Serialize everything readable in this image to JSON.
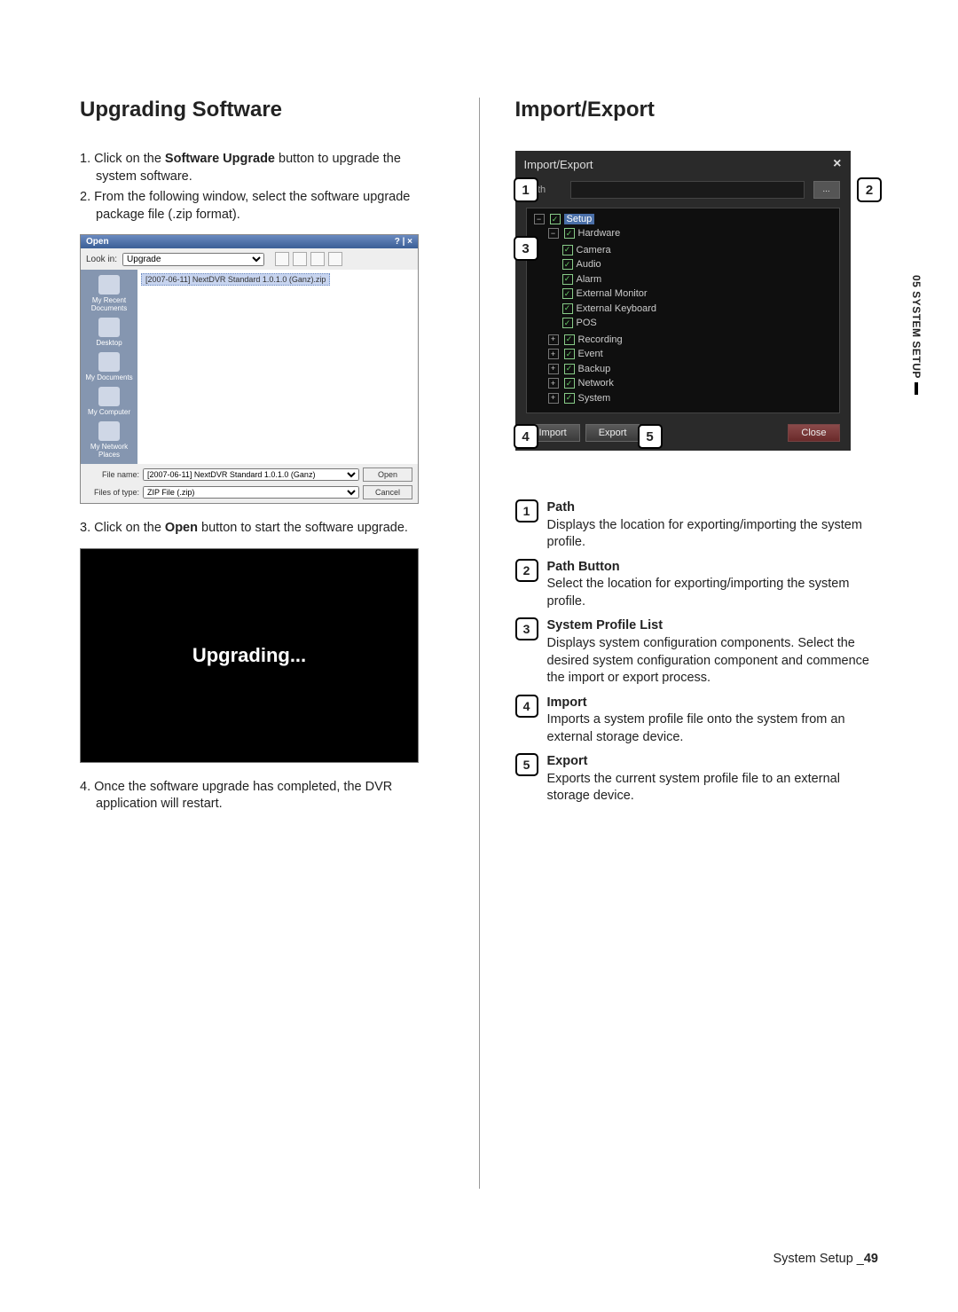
{
  "left": {
    "heading": "Upgrading Software",
    "steps": [
      {
        "pre": "1. Click on the ",
        "bold": "Software Upgrade",
        "post": " button to upgrade the system software."
      },
      {
        "pre": "2. From the following window, select the software upgrade package file (.zip format).",
        "bold": "",
        "post": ""
      },
      {
        "pre": "3. Click on the ",
        "bold": "Open",
        "post": " button to start the software upgrade."
      },
      {
        "pre": "4. Once the software upgrade has completed, the DVR application will restart.",
        "bold": "",
        "post": ""
      }
    ],
    "open_dialog": {
      "title": "Open",
      "window_buttons": "? | ×",
      "look_in_label": "Look in:",
      "look_in_value": "Upgrade",
      "places": [
        "My Recent Documents",
        "Desktop",
        "My Documents",
        "My Computer",
        "My Network Places"
      ],
      "selected_file": "[2007-06-11] NextDVR Standard 1.0.1.0 (Ganz).zip",
      "filename_label": "File name:",
      "filename_value": "[2007-06-11] NextDVR Standard 1.0.1.0 (Ganz)",
      "filetype_label": "Files of type:",
      "filetype_value": "ZIP File (.zip)",
      "open_btn": "Open",
      "cancel_btn": "Cancel"
    },
    "upgrading_text": "Upgrading..."
  },
  "right": {
    "heading": "Import/Export",
    "panel": {
      "title": "Import/Export",
      "path_label": "Path",
      "browse_label": "...",
      "tree": {
        "root": "Setup",
        "setup_children": [
          "Hardware",
          "Recording",
          "Event",
          "Backup",
          "Network",
          "System"
        ],
        "hardware_children": [
          "Camera",
          "Audio",
          "Alarm",
          "External Monitor",
          "External Keyboard",
          "POS"
        ]
      },
      "import_btn": "Import",
      "export_btn": "Export",
      "close_btn": "Close"
    },
    "callouts": [
      "1",
      "2",
      "3",
      "4",
      "5"
    ],
    "defs": [
      {
        "num": "1",
        "title": "Path",
        "body": "Displays the location for exporting/importing the system profile."
      },
      {
        "num": "2",
        "title": "Path Button",
        "body": "Select the location for exporting/importing the system profile."
      },
      {
        "num": "3",
        "title": "System Profile List",
        "body": "Displays system configuration components. Select the desired system configuration component and commence the import or export process."
      },
      {
        "num": "4",
        "title": "Import",
        "body": "Imports a system profile file onto the system from an external storage device."
      },
      {
        "num": "5",
        "title": "Export",
        "body": "Exports the current system profile file to an external storage device."
      }
    ]
  },
  "sidetab": "05 SYSTEM SETUP",
  "footer": {
    "label": "System Setup _",
    "page": "49"
  }
}
